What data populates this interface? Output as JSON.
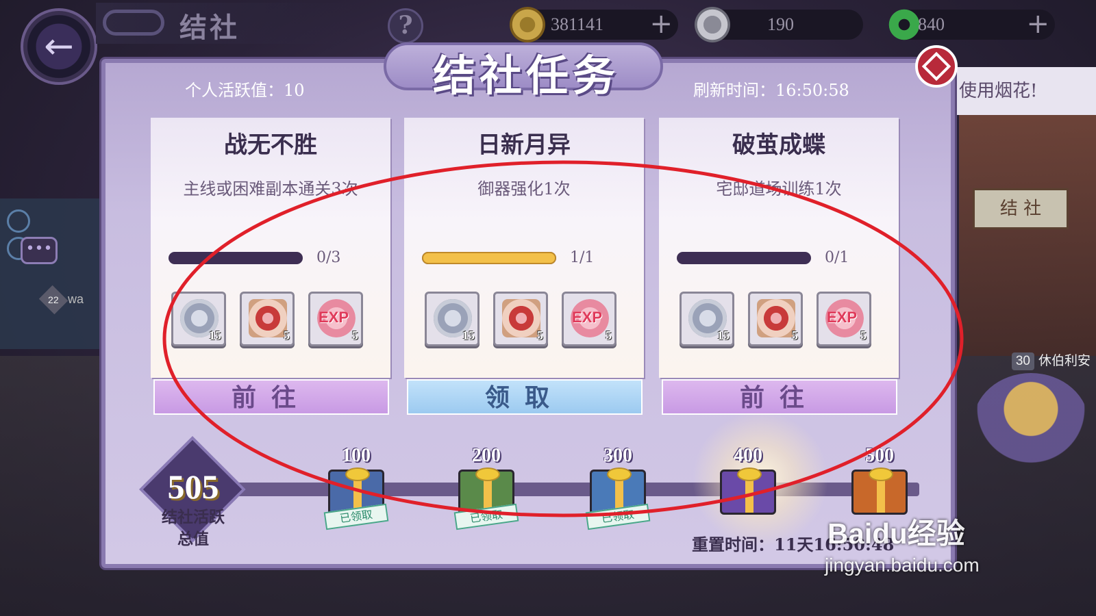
{
  "topbar": {
    "title": "结社",
    "help_glyph": "?",
    "currencies": [
      {
        "name": "gold-coin",
        "value": "381141",
        "has_plus": true
      },
      {
        "name": "silver-coin",
        "value": "190",
        "has_plus": false
      },
      {
        "name": "green-gem",
        "value": "840",
        "has_plus": true
      }
    ],
    "plus_glyph": "+"
  },
  "background": {
    "banner_text": "使用烟花!",
    "sign_text": "结 社",
    "left_player_level": "22",
    "left_player_name": "wa",
    "right_player_level": "30",
    "right_player_name": "休伯利安",
    "chat_glyph": "•••"
  },
  "panel": {
    "title": "结社任务",
    "personal_activity": "个人活跃值：10",
    "refresh_time": "刷新时间：16:50:58"
  },
  "tasks": [
    {
      "name": "战无不胜",
      "desc": "主线或困难副本通关3次",
      "progress_text": "0/3",
      "progress": 0.0,
      "rewards": [
        {
          "type": "coin",
          "qty": "15"
        },
        {
          "type": "seal",
          "qty": "5"
        },
        {
          "type": "exp",
          "label": "EXP",
          "qty": "5"
        }
      ],
      "button": "前往",
      "button_type": "goto"
    },
    {
      "name": "日新月异",
      "desc": "御器强化1次",
      "progress_text": "1/1",
      "progress": 1.0,
      "rewards": [
        {
          "type": "coin",
          "qty": "15"
        },
        {
          "type": "seal",
          "qty": "5"
        },
        {
          "type": "exp",
          "label": "EXP",
          "qty": "5"
        }
      ],
      "button": "领取",
      "button_type": "claim"
    },
    {
      "name": "破茧成蝶",
      "desc": "宅邸道场训练1次",
      "progress_text": "0/1",
      "progress": 0.0,
      "rewards": [
        {
          "type": "coin",
          "qty": "15"
        },
        {
          "type": "seal",
          "qty": "5"
        },
        {
          "type": "exp",
          "label": "EXP",
          "qty": "5"
        }
      ],
      "button": "前往",
      "button_type": "goto"
    }
  ],
  "activity": {
    "total_value": "505",
    "total_label_1": "结社活跃",
    "total_label_2": "总值",
    "milestones": [
      {
        "value": "100",
        "claimed": true,
        "stamp": "已领取",
        "color": "#4a6aa8"
      },
      {
        "value": "200",
        "claimed": true,
        "stamp": "已领取",
        "color": "#5a8a4a"
      },
      {
        "value": "300",
        "claimed": true,
        "stamp": "已领取",
        "color": "#4a7ab8"
      },
      {
        "value": "400",
        "claimed": false,
        "stamp": "",
        "color": "#6a4aa8"
      },
      {
        "value": "500",
        "claimed": false,
        "stamp": "",
        "color": "#c8682a"
      }
    ],
    "reset_time": "重置时间：11天16:50:48"
  },
  "watermark": {
    "brand": "Baidu经验",
    "url": "jingyan.baidu.com"
  },
  "colors": {
    "annotation_ellipse": "#e0202a",
    "progress_fill": "#f3c04a",
    "progress_empty": "#3e2e54",
    "close_button": "#b82a3a"
  }
}
